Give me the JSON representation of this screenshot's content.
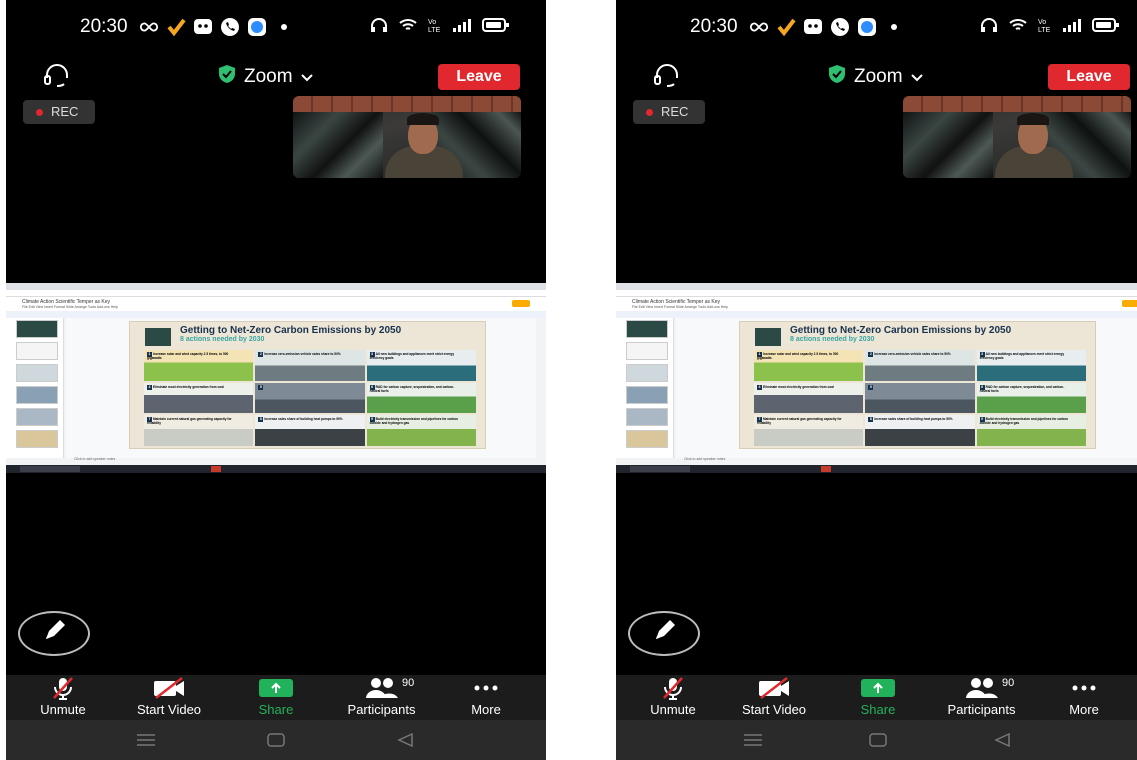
{
  "colors": {
    "leave": "#e0282e",
    "share": "#23b25c",
    "shield": "#2fbf71",
    "rec_dot": "#e0282e"
  },
  "status_bar": {
    "time": "20:30",
    "icons": [
      "infinity-icon",
      "check-icon",
      "message-icon",
      "phone-icon",
      "blue-app-icon",
      "dot-icon"
    ],
    "right_icons": [
      "headphones-icon",
      "wifi-icon",
      "volte-icon",
      "signal-icon",
      "battery-icon"
    ]
  },
  "meeting": {
    "title": "Zoom",
    "leave_label": "Leave",
    "rec_label": "REC"
  },
  "shared_screen": {
    "doc_title": "Climate Action Scientific Temper as Key",
    "menu_items": "File  Edit  View  Insert  Format  Slide  Arrange  Tools  Add-ons  Help",
    "slide_title": "Getting to Net-Zero Carbon Emissions by 2050",
    "slide_subtitle": "8 actions needed by 2030",
    "speaker_notes": "Click to add speaker notes",
    "cells": [
      {
        "num": "1",
        "text": "Increase solar and wind capacity 2.5 times, to 500 gigawatts"
      },
      {
        "num": "2",
        "text": "Increase zero-emission vehicle sales share to 50%"
      },
      {
        "num": "3",
        "text": "All new buildings and appliances meet strict energy efficiency goals"
      },
      {
        "num": "4",
        "text": "Eliminate most electricity generation from coal"
      },
      {
        "num": "5",
        "text": ""
      },
      {
        "num": "6",
        "text": "R&D for carbon capture, sequestration, and carbon-neutral fuels"
      },
      {
        "num": "7",
        "text": "Maintain current natural gas generating capacity for reliability"
      },
      {
        "num": "8",
        "text": "Increase sales share of building heat pumps to 50%"
      },
      {
        "num": "9",
        "text": "Build electricity transmission and pipelines for carbon dioxide and hydrogen gas"
      }
    ]
  },
  "toolbar": {
    "unmute_label": "Unmute",
    "start_video_label": "Start Video",
    "share_label": "Share",
    "participants_label": "Participants",
    "participants_count": "90",
    "more_label": "More"
  }
}
